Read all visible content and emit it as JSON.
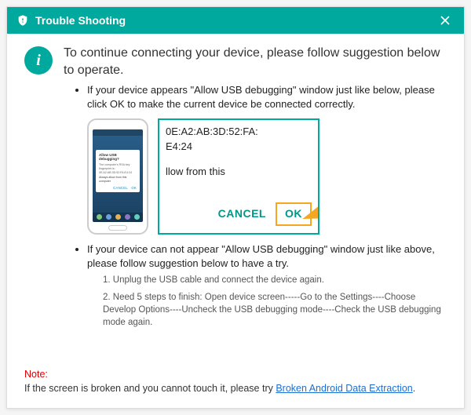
{
  "titlebar": {
    "title": "Trouble Shooting"
  },
  "intro": {
    "badge": "i",
    "text": "To continue connecting your device, please follow suggestion below to operate."
  },
  "bullet1": {
    "text": "If your device appears \"Allow USB debugging\" window just like below, please click OK to make the current device  be connected correctly."
  },
  "phone_popup": {
    "title": "Allow USB debugging?",
    "body": "The computer's RSA key fingerprint is: 0E:A2:AB:3D:52:FA:E4:24",
    "checkbox": "Always allow from this computer",
    "cancel": "CANCEL",
    "ok": "OK"
  },
  "callout": {
    "mac_line1": "0E:A2:AB:3D:52:FA:",
    "mac_line2": "E4:24",
    "allow_from": "llow from this",
    "cancel": "CANCEL",
    "ok": "OK"
  },
  "bullet2": {
    "text": "If your device can not appear \"Allow USB debugging\" window just like above, please follow suggestion below to have a try.",
    "step1": "1. Unplug the USB cable and connect the device again.",
    "step2": "2. Need 5 steps to finish: Open device screen-----Go to the Settings----Choose Develop Options----Uncheck the USB debugging mode----Check the USB debugging mode again."
  },
  "note": {
    "label": "Note:",
    "text": "If the screen is broken and you cannot touch it, please try ",
    "link": "Broken Android Data Extraction",
    "suffix": "."
  }
}
